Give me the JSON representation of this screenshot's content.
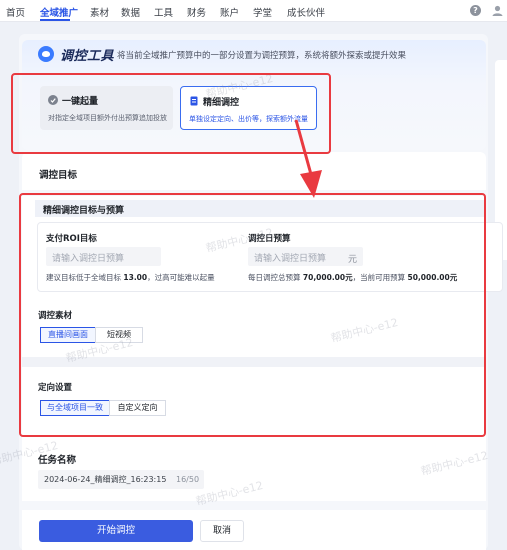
{
  "nav": {
    "items": [
      "首页",
      "全域推广",
      "素材",
      "数据",
      "工具",
      "财务",
      "账户",
      "学堂",
      "成长伙伴"
    ],
    "help_symbol": "?"
  },
  "tool": {
    "title": "调控工具",
    "description": "将当前全域推广预算中的一部分设置为调控预算，系统将额外探索或提升效果",
    "modes": [
      {
        "title": "一键起量",
        "subtitle": "对指定全域项目额外付出预算追加投放"
      },
      {
        "title": "精细调控",
        "subtitle": "单独设定定向、出价等，探索额外流量"
      }
    ]
  },
  "target_section": {
    "label": "调控目标"
  },
  "budget": {
    "title": "精细调控目标与预算",
    "roi": {
      "label": "支付ROI目标",
      "placeholder": "请输入调控日预算",
      "hint_prefix": "建议目标低于全域目标",
      "hint_value": "13.00",
      "hint_suffix": "，过高可能难以起量"
    },
    "daily": {
      "label": "调控日预算",
      "placeholder": "请输入调控日预算",
      "unit": "元",
      "hint_prefix": "每日调控总预算",
      "hint_total": "70,000.00元",
      "hint_mid": "，当前可用预算",
      "hint_available": "50,000.00元"
    },
    "material": {
      "label": "调控素材",
      "options": [
        "直播间画面",
        "短视频"
      ]
    },
    "targeting": {
      "label": "定向设置",
      "options": [
        "与全域项目一致",
        "自定义定向"
      ]
    }
  },
  "task": {
    "label": "任务名称",
    "value": "2024-06-24_精细调控_16:23:15",
    "count": "16/50"
  },
  "actions": {
    "start": "开始调控",
    "cancel": "取消"
  },
  "watermark": "帮助中心-e12",
  "colors": {
    "accent": "#2b55e6",
    "annotation": "#e93a40"
  }
}
